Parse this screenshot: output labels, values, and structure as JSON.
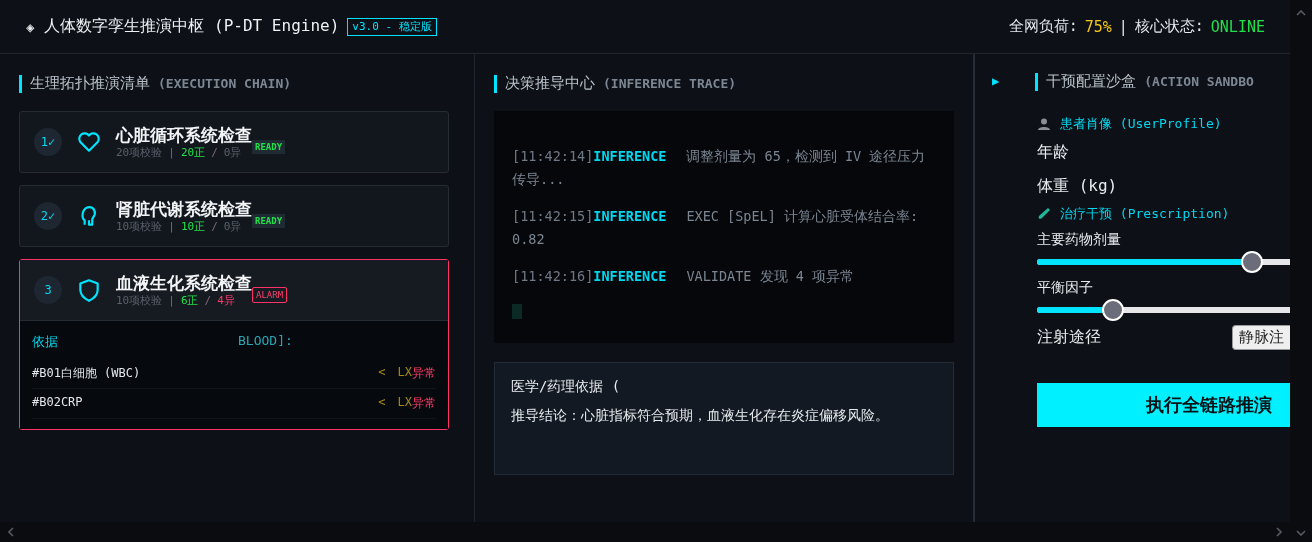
{
  "header": {
    "logo": "◈",
    "title": "人体数字孪生推演中枢 (P-DT Engine)",
    "version": "v3.0 - 稳定版",
    "load_label": "全网负荷:",
    "load_value": "75%",
    "separator": "|",
    "status_label": "核心状态:",
    "status_value": "ONLINE"
  },
  "chain": {
    "title": "生理拓扑推演清单",
    "subtitle": "(EXECUTION CHAIN)",
    "systems": [
      {
        "step": "1✓",
        "kind": "heart",
        "title": "心脏循环系统检查",
        "total": "20项校验",
        "sep": "|",
        "normal": "20正",
        "slash": "/",
        "abnormal": "0异",
        "badge": "READY",
        "alarm": false
      },
      {
        "step": "2✓",
        "kind": "kidney",
        "title": "肾脏代谢系统检查",
        "total": "10项校验",
        "sep": "|",
        "normal": "10正",
        "slash": "/",
        "abnormal": "0异",
        "badge": "READY",
        "alarm": false
      },
      {
        "step": "3",
        "kind": "shield",
        "title": "血液生化系统检查",
        "total": "10项校验",
        "sep": "|",
        "normal": "6正",
        "slash": "/",
        "abnormal": "4异",
        "badge": "ALARM",
        "alarm": true,
        "details": {
          "basis_label": "依据",
          "basis_text": "BLOOD]:",
          "rows": [
            {
              "code": "#B01白细胞 (WBC)",
              "prefix": "<",
              "value": "LX",
              "status": "异常"
            },
            {
              "code": "#B02CRP",
              "prefix": "<",
              "value": "LX",
              "status": "异常"
            }
          ]
        }
      }
    ]
  },
  "trace": {
    "title": "决策推导中心",
    "subtitle": "(INFERENCE TRACE)",
    "logs": [
      {
        "time": "[11:42:14]",
        "level": "INFERENCE",
        "message": "调整剂量为 65，检测到 IV 途径压力传导..."
      },
      {
        "time": "[11:42:15]",
        "level": "INFERENCE",
        "message": "EXEC [SpEL] 计算心脏受体结合率: 0.82"
      },
      {
        "time": "[11:42:16]",
        "level": "INFERENCE",
        "message": "VALIDATE 发现 4 项异常"
      }
    ],
    "evidence": {
      "title": "医学/药理依据 (",
      "conclusion": "推导结论：心脏指标符合预期，血液生化存在炎症偏移风险。"
    }
  },
  "sandbox": {
    "toggle": "▶",
    "title": "干预配置沙盒",
    "subtitle": "(ACTION SANDBO",
    "profile": {
      "heading": "患者肖像 (UserProfile)",
      "fields": [
        "年龄",
        "体重 (kg)"
      ]
    },
    "prescription": {
      "heading": "治疗干预 (Prescription)",
      "sliders": [
        {
          "label": "主要药物剂量",
          "level": 0.85
        },
        {
          "label": "平衡因子",
          "level": 0.3
        }
      ],
      "route": {
        "label": "注射途径",
        "value": "静脉注"
      }
    },
    "run_button": "执行全链路推演"
  }
}
